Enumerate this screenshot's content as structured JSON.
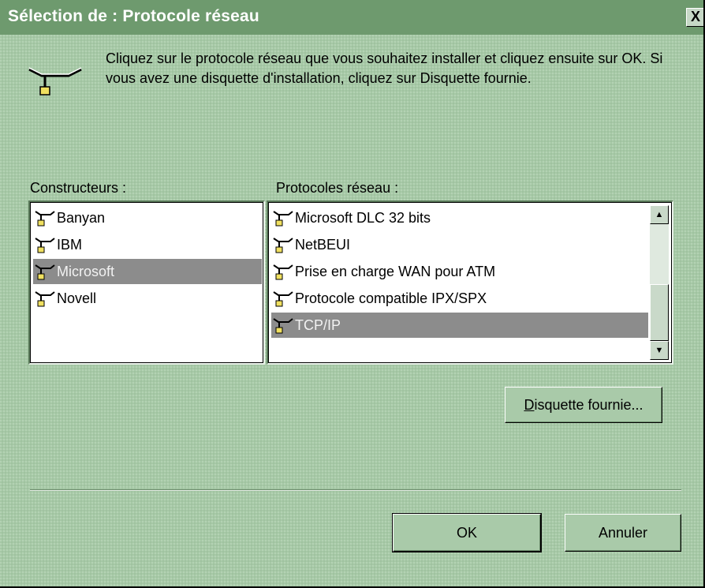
{
  "window": {
    "title": "Sélection de : Protocole réseau",
    "close_label": "X"
  },
  "instruction": "Cliquez sur le protocole réseau que vous souhaitez installer et cliquez ensuite sur OK. Si vous avez une disquette d'installation, cliquez sur Disquette fournie.",
  "constructeurs": {
    "label": "Constructeurs :",
    "items": [
      "Banyan",
      "IBM",
      "Microsoft",
      "Novell"
    ],
    "selected": "Microsoft"
  },
  "protocoles": {
    "label": "Protocoles réseau :",
    "items": [
      "Microsoft DLC 32 bits",
      "NetBEUI",
      "Prise en charge WAN pour ATM",
      "Protocole compatible IPX/SPX",
      "TCP/IP"
    ],
    "selected": "TCP/IP"
  },
  "buttons": {
    "disquette_underline": "D",
    "disquette_rest": "isquette fournie...",
    "ok": "OK",
    "annuler": "Annuler"
  },
  "icons": {
    "network_protocol": "network-protocol-icon"
  },
  "colors": {
    "title_bar": "#6e9a6e",
    "dialog_bg": "#a6c9a6",
    "selection": "#8c8c8c"
  }
}
